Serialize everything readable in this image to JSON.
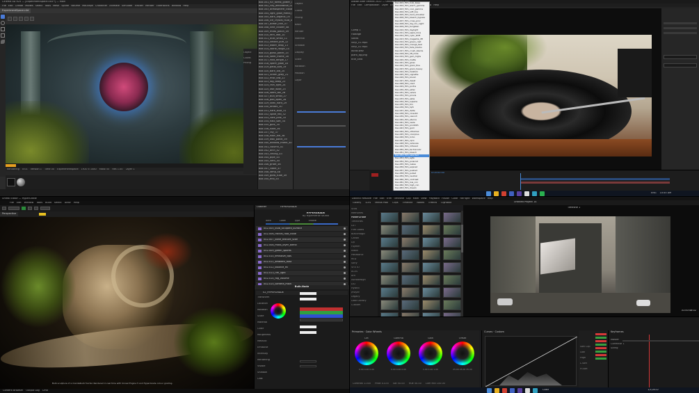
{
  "q1": {
    "title": "Cinema 4D R25 — [ExperimentSpace.c4d *] — Main",
    "menu": [
      "File",
      "Edit",
      "Create",
      "Modes",
      "Select",
      "Tools",
      "Mesh",
      "Spline",
      "Volume",
      "MoGraph",
      "Character",
      "Animate",
      "Simulate",
      "Tracker",
      "Render",
      "Extensions",
      "Window",
      "Help"
    ],
    "tab": "ExperimentSpace.c4d",
    "status_parts": [
      "Rendering",
      "0:01",
      "Version 1",
      "Time 00",
      "Experimentspace",
      "1920 x 1080",
      "Mask 55",
      "Res 1.00",
      "Layer 1"
    ],
    "list_items": [
      "Box.001_fur_forest_glitter_01",
      "Box.002_city_decorative_02",
      "Box.003_atmosphere_cloud_03",
      "Box.004_light_glow_metal_04",
      "Box.005_dark_organic_05",
      "Box.006_ice_crystal_fluid_06",
      "Box.007_ocean_thin_07",
      "Box.008_vine_cluster_08",
      "Box.009_moss_patch_09",
      "Box.010_fern_leaf_10",
      "Box.011_dust_small_11",
      "Box.012_smoke_puff_12",
      "Box.013_water_drop_13",
      "Box.014_stone_rough_14",
      "Box.015_glass_panel_15",
      "Box.016_steel_frame_16",
      "Box.017_root_tangle_17",
      "Box.018_spore_glow_18",
      "Box.019_petal_soft_19",
      "Box.020_bark_old_20",
      "Box.021_lichen_gray_21",
      "Box.022_mist_low_22",
      "Box.023_fog_deep_23",
      "Box.024_rain_light_24",
      "Box.025_leaf_wide_25",
      "Box.026_stem_tall_26",
      "Box.027_bud_small_27",
      "Box.028_pod_open_28",
      "Box.029_shell_hard_29",
      "Box.030_tendril_30",
      "Box.031_flare_blue_31",
      "Box.032_spike_red_32",
      "Box.033_core_pink_33",
      "Box.034_halo_soft_34",
      "Box.035_glint_35",
      "Box.036_haze_36",
      "Box.037_ray_37",
      "Box.038_floor_tile_38",
      "Box.039_wall_panel_39",
      "Box.040_window_frame_40",
      "Box.041_column_41",
      "Box.042_arch_42",
      "Box.043_ceiling_43",
      "Box.044_pipe_44",
      "Box.045_vent_45",
      "Box.046_grate_46",
      "Box.047_cable_47",
      "Box.048_lamp_48",
      "Box.049_glow_tube_49",
      "Box.050_end_50"
    ],
    "attr_labels": [
      "Object",
      "Coord.",
      "Phong",
      "Basic",
      "Render",
      "Material",
      "Shadow",
      "Display",
      "Scale",
      "Rotation",
      "Position",
      "Layer"
    ]
  },
  "q2": {
    "title": "Adobe After Effects 2022 — Untitled Project.aep",
    "menu": [
      "File",
      "Edit",
      "Composition",
      "Layer",
      "Effect",
      "Animation",
      "View",
      "Window",
      "Help"
    ],
    "project_items": [
      "Comp 1",
      "Footage",
      "Solids",
      "vinyl_01.mp4",
      "vinyl_02.mp4",
      "audio.wav",
      "plant_bg.png",
      "title_card"
    ],
    "dropdown_items": [
      "Dev.001_film_look_base",
      "Dev.002_film_warm_gamma",
      "Dev.003_film_cool_gamma",
      "Dev.004_film_soft_toe",
      "Dev.005_film_hard_shoulder",
      "Dev.006_film_bleach_bypass",
      "Dev.007_film_cross_proc",
      "Dev.008_film_day_for_night",
      "Dev.009_film_tungsten",
      "Dev.010_film_daylight",
      "Dev.011_film_sepia_tone",
      "Dev.012_film_cyan_shift",
      "Dev.013_film_magenta_lift",
      "Dev.014_film_green_cast",
      "Dev.015_film_orange_teal",
      "Dev.016_film_fade_blacks",
      "Dev.017_film_crush_blacks",
      "Dev.018_film_lift_mids",
      "Dev.019_film_gain_highs",
      "Dev.020_film_matte",
      "Dev.021_film_gloss",
      "Dev.022_film_grain_fine",
      "Dev.023_film_grain_heavy",
      "Dev.024_film_halation",
      "Dev.025_film_vignette",
      "Dev.026_film_bloom",
      "Dev.027_film_desat",
      "Dev.028_film_vivid",
      "Dev.029_film_portra",
      "Dev.030_film_ektar",
      "Dev.031_film_velvia",
      "Dev.032_film_provia",
      "Dev.033_film_astia",
      "Dev.034_film_superia",
      "Dev.035_film_trix",
      "Dev.036_film_hp5",
      "Dev.037_film_delta",
      "Dev.038_film_cinestill",
      "Dev.039_film_vision3",
      "Dev.040_film_eterna",
      "Dev.041_film_reala",
      "Dev.042_film_pro400h",
      "Dev.043_film_gold",
      "Dev.044_film_ultramax",
      "Dev.045_film_colorplus",
      "Dev.046_film_lomo",
      "Dev.047_film_xpro",
      "Dev.048_film_redscale",
      "Dev.049_film_infrared",
      "Dev.050_film_technicolor",
      "Dev.051_film_bleach",
      "Dev.052_film_selected",
      "Dev.053_film_agfa",
      "Dev.054_film_polaroid",
      "Dev.055_film_instax",
      "Dev.056_film_expired",
      "Dev.057_film_pushed",
      "Dev.058_film_pulled",
      "Dev.059_film_neutral",
      "Dev.060_film_contrast",
      "Dev.061_film_low_con",
      "Dev.062_film_high_con",
      "Dev.063_film_dream",
      "Dev.064_film_noir"
    ],
    "selected_index": 51,
    "timeline_time": "0:00:00:00"
  },
  "q3": {
    "title": "Unreal Editor — HyperGrade",
    "menu": [
      "File",
      "Edit",
      "Window",
      "Tools",
      "Build",
      "Select",
      "Actor",
      "Help"
    ],
    "viewport_tab": "Perspective",
    "outliner_tab": "Outliner",
    "details_tab": "HYPERGRADE",
    "panel_header": "HYPERGRADE",
    "panel_sub": "By Hyperverse Studio",
    "col_headers": [
      "Item",
      "Label",
      "Type",
      "Visible"
    ],
    "layer_items": [
      "002-005_bulb_sculpted_surface",
      "002-006_fractal_root_node",
      "002-007_bone_texture_scan",
      "002-008_moss_layer_blend",
      "002-009_green_spores",
      "002-010_emissive_tips",
      "002-011_ambient_dust",
      "002-012_bounce_fill",
      "002-013_rim_light",
      "002-014_fog_volume",
      "002-015_camera_main"
    ],
    "section_title": "Bulb.Node",
    "details_label": "02_HYPERGRADE",
    "props": [
      "Transform",
      "Location",
      "Rotation",
      "Scale",
      "Material",
      "Color",
      "Roughness",
      "Metallic",
      "Emissive",
      "Intensity",
      "Rendering",
      "Visible",
      "Shadow",
      "Cast"
    ],
    "caption": "Bulb sculpture of a mandelbulb fractal. Rendered in real time with Unreal Engine 5 and HyperGrade colour grading.",
    "content_browser": "Content Browser",
    "output_log": "Output Log",
    "cmd": "Cmd"
  },
  "q4": {
    "title": "Untitled Project 14",
    "menu": [
      "DaVinci Resolve",
      "File",
      "Edit",
      "Trim",
      "Timeline",
      "Clip",
      "Mark",
      "View",
      "Playback",
      "Fusion",
      "Color",
      "Fairlight",
      "Workspace",
      "Help"
    ],
    "tabs": [
      "Gallery",
      "LUTs",
      "Media Pool",
      "Clips",
      "Timeline",
      "Nodes",
      "Effects",
      "Lightbox"
    ],
    "sidebar_items": [
      "Stills",
      "Memories",
      "PowerGrade",
      "Timelines",
      "LUT",
      "Film Looks",
      "Blackmagic",
      "Canon",
      "DJI",
      "Fujifilm",
      "Nikon",
      "Panasonic",
      "RED",
      "Sony",
      "VFX IO",
      "ACES",
      "Arri",
      "Astrodesign",
      "DCI",
      "Hybrid",
      "JPlayer",
      "Legacy",
      "Look Library",
      "Custom"
    ],
    "timeline_name": "Timeline 1",
    "timecode": "01:00:48:02",
    "wheels_tab": "Primaries · Color Wheels",
    "curves_tab": "Curves · Custom",
    "keyframes_tab": "Keyframes",
    "wheel_labels": [
      "Lift",
      "Gamma",
      "Gain",
      "Offset"
    ],
    "wheel_values": [
      "0.00  0.00  0.00",
      "0.00  0.00  0.00",
      "1.00  1.00  1.00",
      "25.00  25.00  25.00"
    ],
    "bottom_params": [
      "Contrast 1.000",
      "Pivot 0.435",
      "Sat 50.00",
      "Hue 50.00",
      "Lum Mix 100.00"
    ],
    "soft_clip_labels": [
      "Soft Clip",
      "Low",
      "High",
      "L.Soft",
      "H.Soft"
    ],
    "kf_rows": [
      "Master",
      "Corrector 1",
      "Sizing"
    ],
    "pages": [
      "Media",
      "Cut",
      "Edit",
      "Fusion",
      "Color",
      "Fairlight",
      "Deliver"
    ],
    "clip_count": 56
  },
  "taskbar": {
    "time": "10:45 AM",
    "date": "1/1/2022",
    "lang": "ENG"
  },
  "colors": {
    "accent_c4d": "#4a7bd8",
    "accent_ue": "#2a5ea8",
    "resolve_red": "#d63838",
    "ae_selected": "#4a8bd8"
  }
}
